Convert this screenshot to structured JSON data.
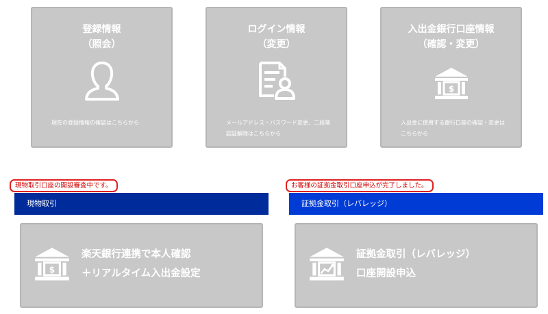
{
  "colors": {
    "card_bg": "#c8c8c8",
    "card_text": "#ffffff",
    "bar_spot": "#002b9a",
    "bar_margin": "#003bd6",
    "notice_red": "#d00000"
  },
  "top_cards": [
    {
      "title_line1": "登録情報",
      "title_line2": "（照会）",
      "icon": "person-icon",
      "description": "現在の登録情報の確認はこちらから"
    },
    {
      "title_line1": "ログイン情報",
      "title_line2": "（変更）",
      "icon": "document-user-icon",
      "description": "メールアドレス・パスワード変更、二段階認証解除はこちらから"
    },
    {
      "title_line1": "入出金銀行口座情報",
      "title_line2": "（確認・変更）",
      "icon": "bank-icon",
      "description": "入出金に使用する銀行口座の確認・変更はこちらから"
    }
  ],
  "spot_section": {
    "notice": "現物取引口座の開設審査中です。",
    "bar_label": "現物取引",
    "card_line1": "楽天銀行連携で本人確認",
    "card_line2": "＋リアルタイム入出金設定",
    "icon": "bank-icon"
  },
  "margin_section": {
    "notice": "お客様の証拠金取引口座申込が完了しました。",
    "bar_label": "証拠金取引（レバレッジ）",
    "card_line1": "証拠金取引（レバレッジ）",
    "card_line2": "口座開設申込",
    "icon": "bank-chart-icon"
  }
}
